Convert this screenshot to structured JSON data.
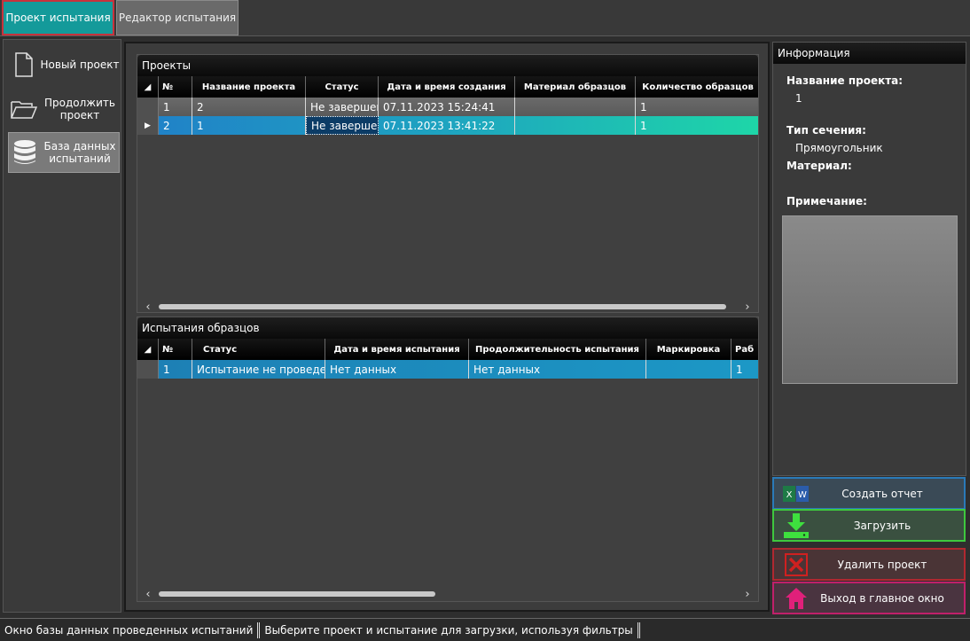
{
  "tabs": {
    "project": "Проект испытания",
    "editor": "Редактор испытания"
  },
  "sidebar": {
    "new_project": "Новый проект",
    "continue_project": "Продолжить проект",
    "database": "База данных испытаний"
  },
  "projects": {
    "title": "Проекты",
    "columns": [
      "№",
      "Название проекта",
      "Статус",
      "Дата и время создания",
      "Материал образцов",
      "Количество образцов"
    ],
    "rows": [
      {
        "num": "1",
        "name": "2",
        "status": "Не завершен",
        "created": "07.11.2023 15:24:41",
        "material": "",
        "count": "1"
      },
      {
        "num": "2",
        "name": "1",
        "status": "Не завершен",
        "created": "07.11.2023 13:41:22",
        "material": "",
        "count": "1"
      }
    ]
  },
  "tests": {
    "title": "Испытания образцов",
    "columns": [
      "№",
      "Статус",
      "Дата и время испытания",
      "Продолжительность испытания",
      "Маркировка",
      "Раб"
    ],
    "rows": [
      {
        "num": "1",
        "status": "Испытание не проведено",
        "date": "Нет данных",
        "duration": "Нет данных",
        "mark": "",
        "extra": "1"
      }
    ]
  },
  "info": {
    "title": "Информация",
    "project_name_label": "Название проекта:",
    "project_name_value": "1",
    "section_label": "Тип сечения:",
    "section_value": "Прямоугольник",
    "material_label": "Материал:",
    "note_label": "Примечание:"
  },
  "actions": {
    "report": "Создать отчет",
    "load": "Загрузить",
    "delete": "Удалить проект",
    "exit": "Выход в главное окно"
  },
  "status": {
    "window": "Окно базы данных проведенных испытаний",
    "hint": "Выберите проект и испытание для загрузки, используя фильтры"
  },
  "icons": {
    "new_project": "document-icon",
    "continue_project": "folder-open-icon",
    "database": "database-icon",
    "report": "excel-word-icon",
    "load": "download-icon",
    "delete": "delete-x-icon",
    "exit": "home-icon"
  },
  "colors": {
    "active_tab": "#149a9a",
    "selected_row": "#2080c8",
    "load_green": "#3ec83e",
    "delete_red": "#b02830",
    "exit_pink": "#c0206a"
  }
}
